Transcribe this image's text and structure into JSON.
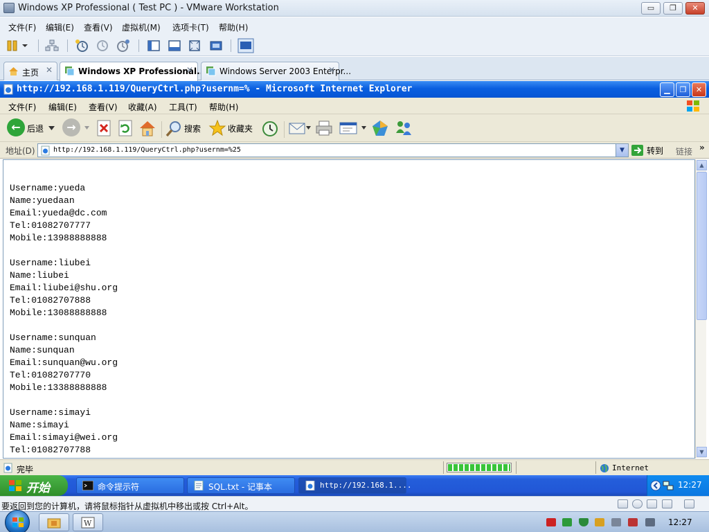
{
  "vmware": {
    "title": "Windows XP Professional ( Test PC ) - VMware Workstation",
    "window_controls": {
      "minimize": "▭",
      "maximize": "❐",
      "close": "✕"
    },
    "menu": [
      "文件(F)",
      "编辑(E)",
      "查看(V)",
      "虚拟机(M)",
      "选项卡(T)",
      "帮助(H)"
    ],
    "tabs": [
      {
        "label": "主页",
        "active": false
      },
      {
        "label": "Windows XP Professional...",
        "active": true
      },
      {
        "label": "Windows Server 2003 Enterpr...",
        "active": false
      }
    ],
    "tab_close": "✕",
    "status_hint": "要返回到您的计算机，请将鼠标指针从虚拟机中移出或按 Ctrl+Alt。"
  },
  "ie": {
    "title": "http://192.168.1.119/QueryCtrl.php?usernm=% - Microsoft Internet Explorer",
    "window_controls": {
      "minimize": "▁",
      "maximize": "❐",
      "close": "✕"
    },
    "menu": [
      "文件(F)",
      "编辑(E)",
      "查看(V)",
      "收藏(A)",
      "工具(T)",
      "帮助(H)"
    ],
    "toolbar": {
      "back": "后退",
      "search": "搜索",
      "favorites": "收藏夹"
    },
    "address_label": "地址(D)",
    "address_value": "http://192.168.1.119/QueryCtrl.php?usernm=%25",
    "go_label": "转到",
    "links_label": "链接",
    "links_chevron": "»",
    "status_text": "完毕",
    "progress": 1.0,
    "zone_text": "Internet",
    "page_lines": [
      "Username:yueda",
      "Name:yuedaan",
      "Email:yueda@dc.com",
      "Tel:01082707777",
      "Mobile:13988888888",
      "",
      "Username:liubei",
      "Name:liubei",
      "Email:liubei@shu.org",
      "Tel:01082707888",
      "Mobile:13088888888",
      "",
      "Username:sunquan",
      "Name:sunquan",
      "Email:sunquan@wu.org",
      "Tel:01082707770",
      "Mobile:13388888888",
      "",
      "Username:simayi",
      "Name:simayi",
      "Email:simayi@wei.org",
      "Tel:01082707788"
    ]
  },
  "xp_taskbar": {
    "start_label": "开始",
    "tasks": [
      {
        "label": "命令提示符",
        "active": false
      },
      {
        "label": "SQL.txt - 记事本",
        "active": false
      },
      {
        "label": "http://192.168.1....",
        "active": true
      }
    ],
    "clock": "12:27"
  },
  "win7_taskbar": {
    "clock": "12:27"
  }
}
